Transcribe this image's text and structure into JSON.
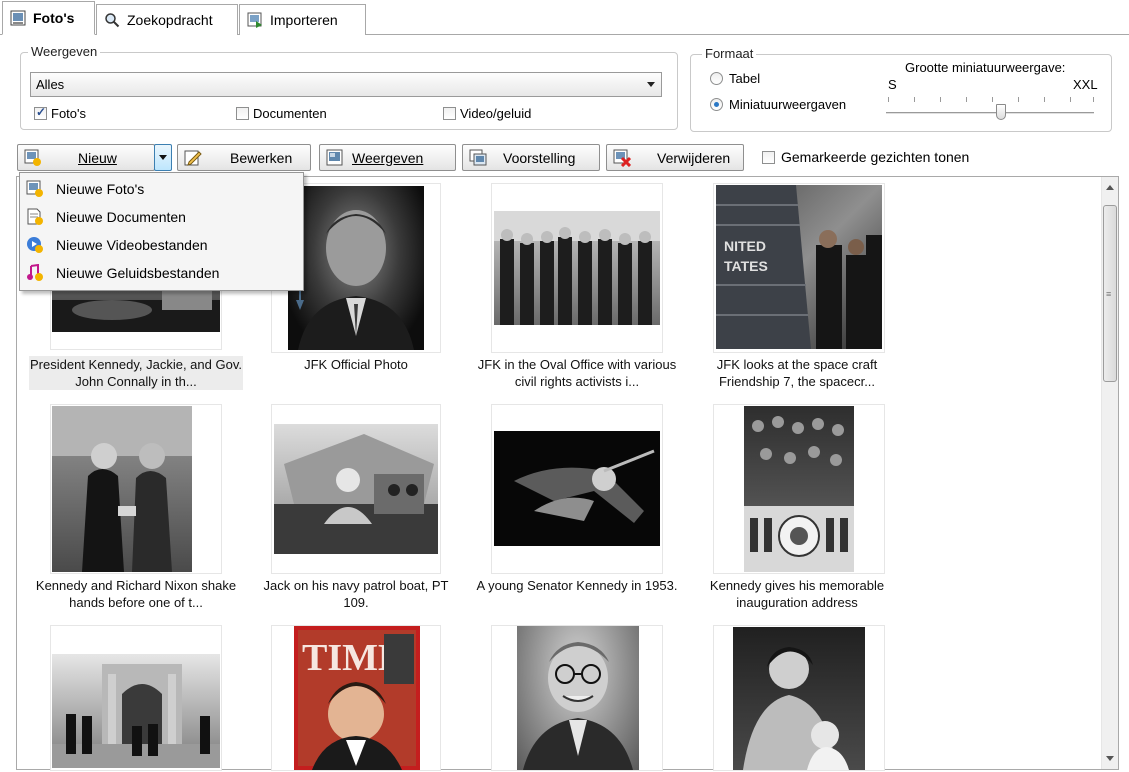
{
  "tabs": [
    {
      "label": "Foto's",
      "icon": "photo-tab-icon",
      "active": true
    },
    {
      "label": "Zoekopdracht",
      "icon": "magnifier-icon",
      "active": false
    },
    {
      "label": "Importeren",
      "icon": "import-icon",
      "active": false
    }
  ],
  "view": {
    "group_label": "Weergeven",
    "filter_selected": "Alles",
    "checkboxes": [
      {
        "label": "Foto's",
        "checked": true
      },
      {
        "label": "Documenten",
        "checked": false
      },
      {
        "label": "Video/geluid",
        "checked": false
      }
    ]
  },
  "format": {
    "group_label": "Formaat",
    "options": [
      {
        "label": "Tabel",
        "selected": false
      },
      {
        "label": "Miniatuurweergaven",
        "selected": true
      }
    ],
    "size_label": "Grootte miniatuurweergave:",
    "size_min": "S",
    "size_max": "XXL",
    "size_level": 0.55
  },
  "toolbar": {
    "new_label": "Nieuw",
    "edit_label": "Bewerken",
    "view_label": "Weergeven",
    "slideshow_label": "Voorstelling",
    "delete_label": "Verwijderen",
    "faces_label": "Gemarkeerde gezichten tonen",
    "faces_checked": false
  },
  "new_menu": [
    {
      "label": "Nieuwe Foto's",
      "icon": "new-photo-icon"
    },
    {
      "label": "Nieuwe Documenten",
      "icon": "new-document-icon"
    },
    {
      "label": "Nieuwe Videobestanden",
      "icon": "new-video-icon"
    },
    {
      "label": "Nieuwe Geluidsbestanden",
      "icon": "new-audio-icon"
    }
  ],
  "photos": [
    {
      "caption": "President Kennedy, Jackie, and Gov. John Connally in th...",
      "selected": true
    },
    {
      "caption": "JFK Official Photo"
    },
    {
      "caption": "JFK in the Oval Office with various civil rights activists i..."
    },
    {
      "caption": "JFK looks at the space craft Friendship 7, the spacecr..."
    },
    {
      "caption": "Kennedy and Richard Nixon shake hands before one of t..."
    },
    {
      "caption": "Jack on his navy patrol boat, PT 109."
    },
    {
      "caption": "A young Senator Kennedy in 1953."
    },
    {
      "caption": "Kennedy gives his memorable inauguration address"
    },
    {
      "caption": ""
    },
    {
      "caption": ""
    },
    {
      "caption": ""
    },
    {
      "caption": ""
    }
  ],
  "magazine_text": "TIME"
}
